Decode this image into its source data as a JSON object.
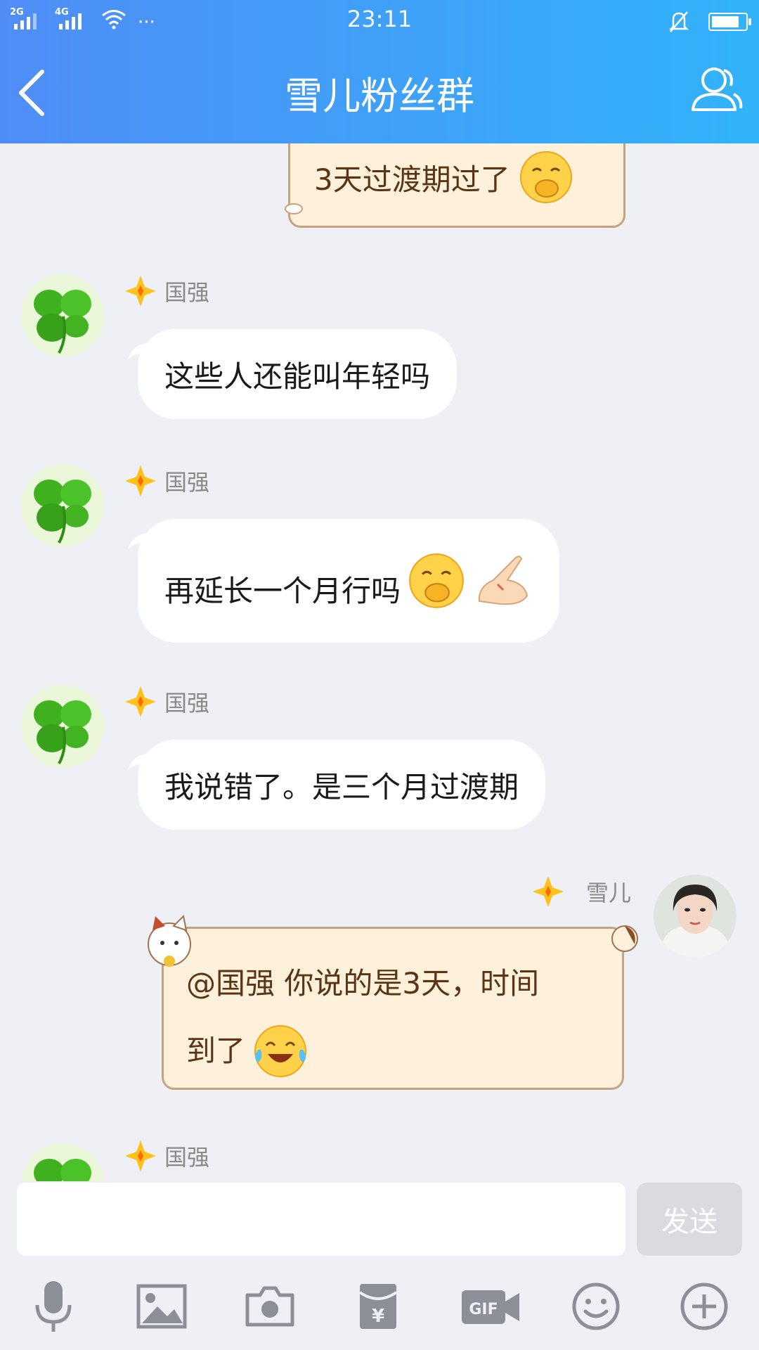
{
  "status_bar": {
    "time": "23:11",
    "network_1": "2G",
    "network_2": "4G",
    "more": "···",
    "icons": [
      "signal-icon",
      "signal-icon",
      "wifi-icon",
      "mute-bell-icon",
      "battery-icon"
    ]
  },
  "header": {
    "title": "雪儿粉丝群",
    "back_icon": "chevron-left-icon",
    "members_icon": "group-members-icon"
  },
  "messages": [
    {
      "sender": "",
      "side": "right",
      "style": "paper",
      "text": "3天过渡期过了",
      "emojis": [
        "cover-mouth-emoji"
      ]
    },
    {
      "sender": "国强",
      "side": "left",
      "style": "bubble",
      "text": "这些人还能叫年轻吗",
      "emojis": []
    },
    {
      "sender": "国强",
      "side": "left",
      "style": "bubble",
      "text": "再延长一个月行吗",
      "emojis": [
        "cover-mouth-emoji",
        "pleading-hands-emoji"
      ]
    },
    {
      "sender": "国强",
      "side": "left",
      "style": "bubble",
      "text": "我说错了。是三个月过渡期",
      "emojis": []
    },
    {
      "sender": "雪儿",
      "side": "right",
      "style": "paper",
      "text_line1": "@国强 你说的是3天，时间",
      "text_line2": "到了",
      "emojis": [
        "tears-of-joy-emoji"
      ]
    },
    {
      "sender": "国强",
      "side": "left",
      "style": "bubble",
      "text": "",
      "emojis": []
    }
  ],
  "input": {
    "placeholder": "",
    "value": "",
    "send_label": "发送"
  },
  "toolbar": {
    "icons": [
      "microphone-icon",
      "image-icon",
      "camera-icon",
      "red-packet-icon",
      "gif-icon",
      "emoji-icon",
      "plus-icon"
    ]
  },
  "colors": {
    "header_start": "#4f8df6",
    "header_end": "#31b3f9",
    "background": "#eff0f5",
    "paper_bubble": "#fdf1dc",
    "paper_border": "#c7a27e",
    "send_disabled": "#d9dbe0"
  }
}
